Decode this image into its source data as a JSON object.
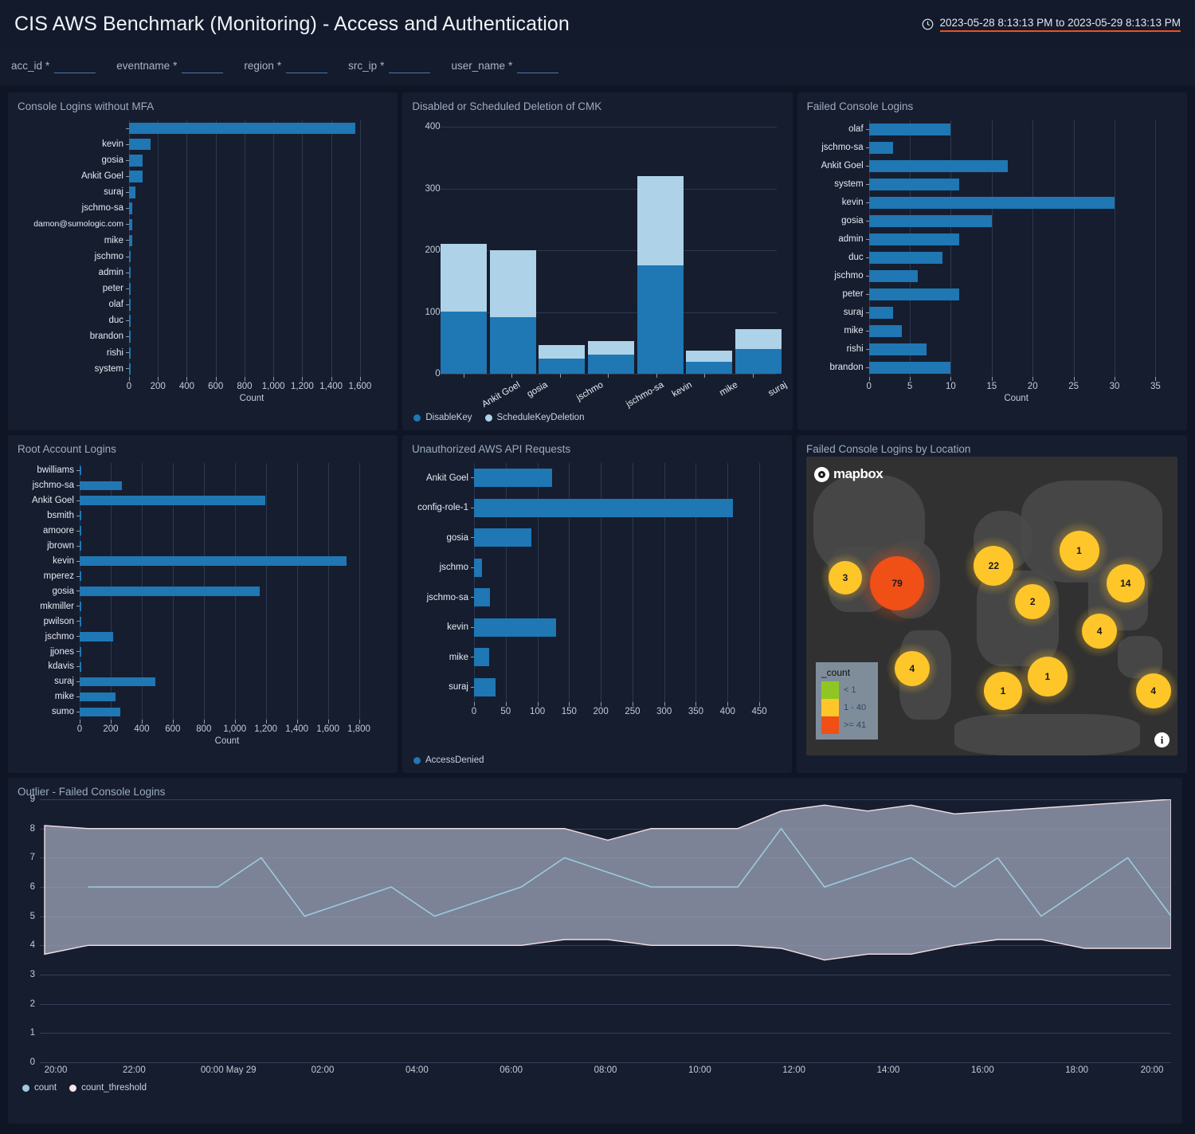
{
  "header": {
    "title": "CIS AWS Benchmark (Monitoring) - Access and Authentication",
    "clock_icon": "clock-icon",
    "time_range": "2023-05-28 8:13:13 PM to 2023-05-29 8:13:13 PM"
  },
  "filters": [
    {
      "label": "acc_id",
      "required": "*",
      "value": ""
    },
    {
      "label": "eventname",
      "required": "*",
      "value": ""
    },
    {
      "label": "region",
      "required": "*",
      "value": ""
    },
    {
      "label": "src_ip",
      "required": "*",
      "value": ""
    },
    {
      "label": "user_name",
      "required": "*",
      "value": ""
    }
  ],
  "colors": {
    "series_primary": "#1f77b4",
    "series_secondary": "#aed3e8",
    "count_line": "#9ecae1",
    "threshold_band": "#9aa0b4",
    "accent_underline": "#f04f23",
    "map_low": "#8fc722",
    "map_mid": "#ffc62a",
    "map_high": "#f04f16"
  },
  "panels": {
    "console_logins_no_mfa": {
      "title": "Console Logins without MFA"
    },
    "cmk": {
      "title": "Disabled or Scheduled Deletion of CMK"
    },
    "failed_console_logins": {
      "title": "Failed Console Logins"
    },
    "root_account_logins": {
      "title": "Root Account Logins"
    },
    "unauthorized_api": {
      "title": "Unauthorized AWS API Requests"
    },
    "map": {
      "title": "Failed Console Logins by Location",
      "provider": "mapbox",
      "info_icon": "info-icon"
    },
    "outlier": {
      "title": "Outlier - Failed Console Logins"
    }
  },
  "chart_data": [
    {
      "id": "console_logins_no_mfa",
      "type": "bar",
      "orientation": "horizontal",
      "title": "Console Logins without MFA",
      "xlabel": "Count",
      "ylabel": "",
      "xlim": [
        0,
        1700
      ],
      "xticks": [
        0,
        200,
        400,
        600,
        800,
        1000,
        1200,
        1400,
        1600
      ],
      "xticklabels": [
        "0",
        "200",
        "400",
        "600",
        "800",
        "1,000",
        "1,200",
        "1,400",
        "1,600"
      ],
      "grid": true,
      "categories": [
        "",
        "kevin",
        "gosia",
        "Ankit Goel",
        "suraj",
        "jschmo-sa",
        "damon@sumologic.com",
        "mike",
        "jschmo",
        "admin",
        "peter",
        "olaf",
        "duc",
        "brandon",
        "rishi",
        "system"
      ],
      "values": [
        1566,
        150,
        95,
        93,
        42,
        22,
        22,
        21,
        12,
        4,
        3,
        3,
        3,
        3,
        2,
        2
      ]
    },
    {
      "id": "cmk",
      "type": "bar",
      "orientation": "vertical",
      "stacked": true,
      "title": "Disabled or Scheduled Deletion of CMK",
      "xlabel": "",
      "ylabel": "",
      "ylim": [
        0,
        400
      ],
      "yticks": [
        0,
        100,
        200,
        300,
        400
      ],
      "grid": true,
      "legend": [
        "DisableKey",
        "ScheduleKeyDeletion"
      ],
      "legend_position": "bottom-left",
      "categories": [
        "Ankit Goel",
        "gosia",
        "jschmo",
        "jschmo-sa",
        "kevin",
        "mike",
        "suraj"
      ],
      "series": [
        {
          "name": "DisableKey",
          "values": [
            101,
            91,
            24,
            31,
            175,
            20,
            40
          ]
        },
        {
          "name": "ScheduleKeyDeletion",
          "values": [
            109,
            109,
            22,
            22,
            145,
            17,
            32
          ]
        }
      ]
    },
    {
      "id": "failed_console_logins",
      "type": "bar",
      "orientation": "horizontal",
      "title": "Failed Console Logins",
      "xlabel": "Count",
      "xlim": [
        0,
        36
      ],
      "xticks": [
        0,
        5,
        10,
        15,
        20,
        25,
        30,
        35
      ],
      "xticklabels": [
        "0",
        "5",
        "10",
        "15",
        "20",
        "25",
        "30",
        "35"
      ],
      "grid": true,
      "categories": [
        "olaf",
        "jschmo-sa",
        "Ankit Goel",
        "system",
        "kevin",
        "gosia",
        "admin",
        "duc",
        "jschmo",
        "peter",
        "suraj",
        "mike",
        "rishi",
        "brandon"
      ],
      "values": [
        10,
        3,
        17,
        11,
        30,
        15,
        11,
        9,
        6,
        11,
        3,
        4,
        7,
        10
      ]
    },
    {
      "id": "root_account_logins",
      "type": "bar",
      "orientation": "horizontal",
      "title": "Root Account Logins",
      "xlabel": "Count",
      "xlim": [
        0,
        1900
      ],
      "xticks": [
        0,
        200,
        400,
        600,
        800,
        1000,
        1200,
        1400,
        1600,
        1800
      ],
      "xticklabels": [
        "0",
        "200",
        "400",
        "600",
        "800",
        "1,000",
        "1,200",
        "1,400",
        "1,600",
        "1,800"
      ],
      "grid": true,
      "categories": [
        "bwilliams",
        "jschmo-sa",
        "Ankit Goel",
        "bsmith",
        "amoore",
        "jbrown",
        "kevin",
        "mperez",
        "gosia",
        "mkmiller",
        "pwilson",
        "jschmo",
        "jjones",
        "kdavis",
        "suraj",
        "mike",
        "sumo"
      ],
      "values": [
        11,
        270,
        1198,
        10,
        10,
        4,
        1718,
        10,
        1158,
        6,
        9,
        214,
        7,
        9,
        486,
        232,
        262
      ]
    },
    {
      "id": "unauthorized_api",
      "type": "bar",
      "orientation": "horizontal",
      "title": "Unauthorized AWS API Requests",
      "xlabel": "",
      "xlim": [
        0,
        465
      ],
      "xticks": [
        0,
        50,
        100,
        150,
        200,
        250,
        300,
        350,
        400,
        450
      ],
      "xticklabels": [
        "0",
        "50",
        "100",
        "150",
        "200",
        "250",
        "300",
        "350",
        "400",
        "450"
      ],
      "grid": true,
      "legend": [
        "AccessDenied"
      ],
      "categories": [
        "Ankit Goel",
        "config-role-1",
        "gosia",
        "jschmo",
        "jschmo-sa",
        "kevin",
        "mike",
        "suraj"
      ],
      "values": [
        123,
        409,
        90,
        13,
        25,
        130,
        24,
        34
      ]
    },
    {
      "id": "map",
      "type": "scatter",
      "title": "Failed Console Logins by Location",
      "legend_title": "_count",
      "legend_bins": [
        {
          "label": "< 1",
          "color": "#8fc722"
        },
        {
          "label": "1 - 40",
          "color": "#ffc62a"
        },
        {
          "label": ">= 41",
          "color": "#f04f16"
        }
      ],
      "markers": [
        {
          "value": "3",
          "x": 10.5,
          "y": 40.5,
          "r": 21,
          "color": "#ffc62a"
        },
        {
          "value": "79",
          "x": 24.5,
          "y": 42.5,
          "r": 34,
          "color": "#f04f16"
        },
        {
          "value": "22",
          "x": 50.5,
          "y": 36.5,
          "r": 25,
          "color": "#ffc62a"
        },
        {
          "value": "1",
          "x": 73.5,
          "y": 31.5,
          "r": 25,
          "color": "#ffc62a"
        },
        {
          "value": "2",
          "x": 61.0,
          "y": 48.5,
          "r": 22,
          "color": "#ffc62a"
        },
        {
          "value": "14",
          "x": 86.0,
          "y": 42.5,
          "r": 24,
          "color": "#ffc62a"
        },
        {
          "value": "4",
          "x": 79.0,
          "y": 58.5,
          "r": 22,
          "color": "#ffc62a"
        },
        {
          "value": "4",
          "x": 28.5,
          "y": 71.0,
          "r": 22,
          "color": "#ffc62a"
        },
        {
          "value": "1",
          "x": 53.0,
          "y": 78.5,
          "r": 24,
          "color": "#ffc62a"
        },
        {
          "value": "1",
          "x": 65.0,
          "y": 73.5,
          "r": 25,
          "color": "#ffc62a"
        },
        {
          "value": "4",
          "x": 93.5,
          "y": 78.5,
          "r": 22,
          "color": "#ffc62a"
        }
      ]
    },
    {
      "id": "outlier",
      "type": "area",
      "title": "Outlier - Failed Console Logins",
      "ylim": [
        0,
        9
      ],
      "yticks": [
        0,
        1,
        2,
        3,
        4,
        5,
        6,
        7,
        8,
        9
      ],
      "grid": true,
      "legend": [
        "count",
        "count_threshold"
      ],
      "xticklabels": [
        "20:00",
        "22:00",
        "00:00 May 29",
        "02:00",
        "04:00",
        "06:00",
        "08:00",
        "10:00",
        "12:00",
        "14:00",
        "16:00",
        "18:00",
        "20:00"
      ],
      "series": [
        {
          "name": "count",
          "values": [
            null,
            6,
            6,
            6,
            6,
            7,
            5,
            5.5,
            6,
            5,
            5.5,
            6,
            7,
            6.5,
            6,
            6,
            6,
            8,
            6,
            6.5,
            7,
            6,
            7,
            5,
            6,
            7,
            5
          ]
        },
        {
          "name": "count_threshold_upper",
          "values": [
            8.1,
            8,
            8,
            8,
            8,
            8,
            8,
            8,
            8,
            8,
            8,
            8,
            8,
            7.6,
            8,
            8,
            8,
            8.6,
            8.8,
            8.6,
            8.8,
            8.5,
            8.6,
            8.7,
            8.8,
            8.9,
            9.0
          ]
        },
        {
          "name": "count_threshold_lower",
          "values": [
            3.7,
            4,
            4,
            4,
            4,
            4,
            4,
            4,
            4,
            4,
            4,
            4,
            4.2,
            4.2,
            4,
            4,
            4,
            3.9,
            3.5,
            3.7,
            3.7,
            4,
            4.2,
            4.2,
            3.9,
            3.9,
            3.9
          ]
        }
      ]
    }
  ]
}
